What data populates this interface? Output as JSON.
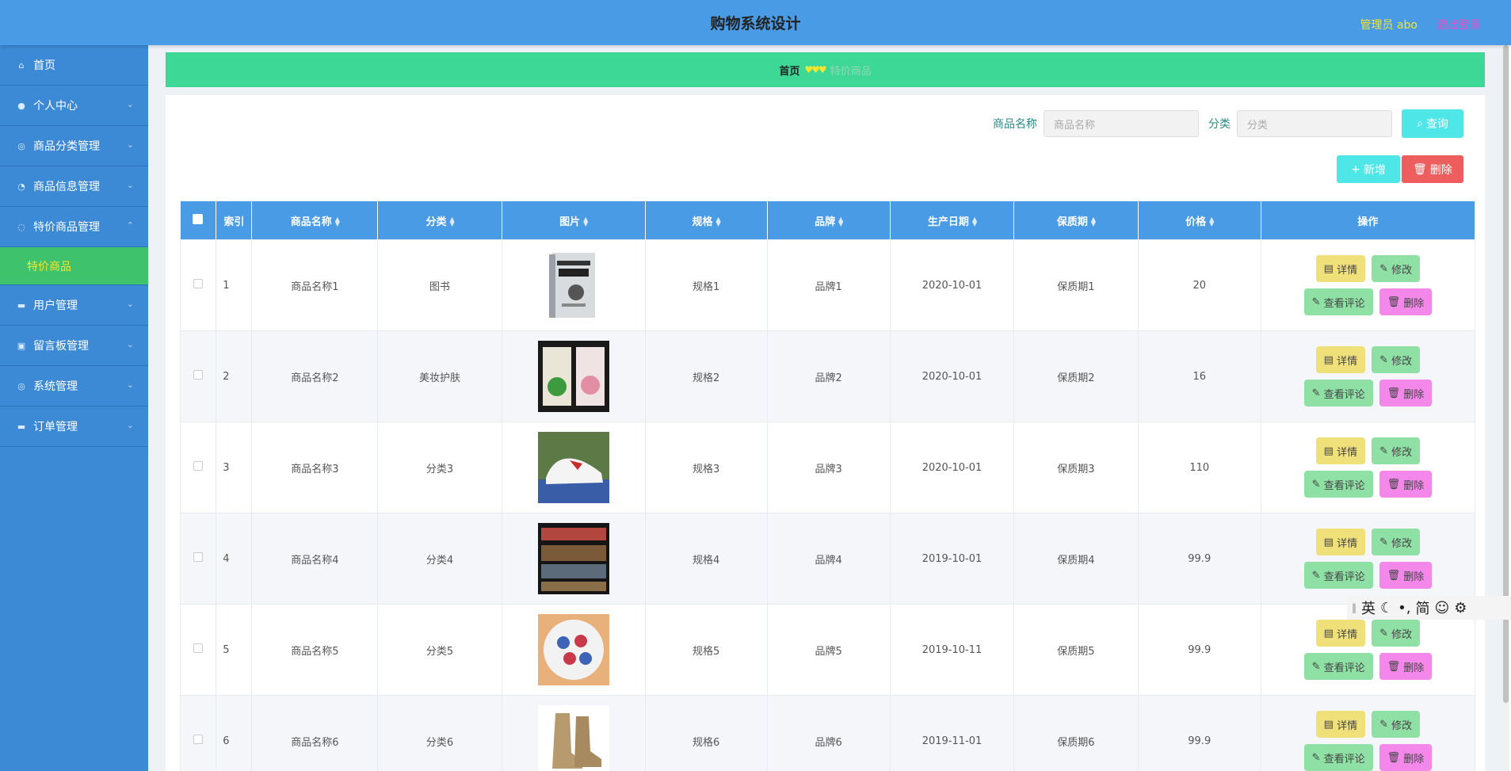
{
  "header": {
    "title": "购物系统设计",
    "user": "管理员 abo",
    "logout": "退出登录"
  },
  "sidebar": {
    "items": [
      {
        "label": "首页",
        "icon": "home-icon"
      },
      {
        "label": "个人中心",
        "icon": "user-icon"
      },
      {
        "label": "商品分类管理",
        "icon": "category-icon"
      },
      {
        "label": "商品信息管理",
        "icon": "goods-icon"
      },
      {
        "label": "特价商品管理",
        "icon": "discount-icon"
      },
      {
        "label": "用户管理",
        "icon": "users-icon"
      },
      {
        "label": "留言板管理",
        "icon": "message-icon"
      },
      {
        "label": "系统管理",
        "icon": "system-icon"
      },
      {
        "label": "订单管理",
        "icon": "order-icon"
      }
    ],
    "sub_item": "特价商品"
  },
  "breadcrumb": {
    "home": "首页",
    "separator": "♥♥♥",
    "current": "特价商品"
  },
  "search": {
    "name_label": "商品名称",
    "name_placeholder": "商品名称",
    "category_label": "分类",
    "category_placeholder": "分类",
    "query_button": "查询"
  },
  "actions": {
    "add": "新增",
    "delete": "删除"
  },
  "table": {
    "headers": [
      "索引",
      "商品名称",
      "分类",
      "图片",
      "规格",
      "品牌",
      "生产日期",
      "保质期",
      "价格",
      "操作"
    ],
    "rows": [
      {
        "index": "1",
        "name": "商品名称1",
        "category": "图书",
        "image": "book-cover",
        "spec": "规格1",
        "brand": "品牌1",
        "date": "2020-10-01",
        "shelf": "保质期1",
        "price": "20"
      },
      {
        "index": "2",
        "name": "商品名称2",
        "category": "美妆护肤",
        "image": "face-masks",
        "spec": "规格2",
        "brand": "品牌2",
        "date": "2020-10-01",
        "shelf": "保质期2",
        "price": "16"
      },
      {
        "index": "3",
        "name": "商品名称3",
        "category": "分类3",
        "image": "sneaker",
        "spec": "规格3",
        "brand": "品牌3",
        "date": "2020-10-01",
        "shelf": "保质期3",
        "price": "110"
      },
      {
        "index": "4",
        "name": "商品名称4",
        "category": "分类4",
        "image": "bookshelf",
        "spec": "规格4",
        "brand": "品牌4",
        "date": "2019-10-01",
        "shelf": "保质期4",
        "price": "99.9"
      },
      {
        "index": "5",
        "name": "商品名称5",
        "category": "分类5",
        "image": "candy-bowl",
        "spec": "规格5",
        "brand": "品牌5",
        "date": "2019-10-11",
        "shelf": "保质期5",
        "price": "99.9"
      },
      {
        "index": "6",
        "name": "商品名称6",
        "category": "分类6",
        "image": "boots",
        "spec": "规格6",
        "brand": "品牌6",
        "date": "2019-11-01",
        "shelf": "保质期6",
        "price": "99.9"
      }
    ],
    "ops": {
      "detail": "详情",
      "edit": "修改",
      "review": "查看评论",
      "remove": "删除"
    }
  },
  "ime": {
    "lang": "英",
    "simplified": "简"
  },
  "colors": {
    "header": "#4a9be6",
    "sidebar": "#3c8ad6",
    "active": "#3ec26b",
    "breadcrumb": "#3dd896"
  }
}
